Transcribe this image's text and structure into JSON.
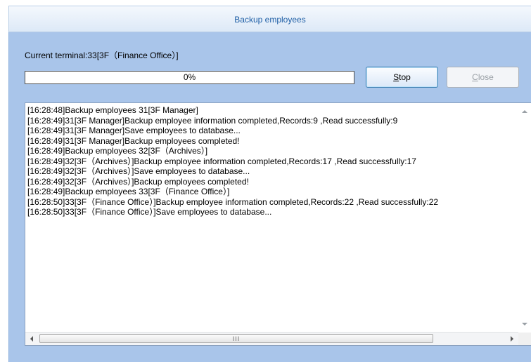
{
  "window": {
    "title": "Backup employees"
  },
  "status": {
    "current_terminal": "Current terminal:33[3F（Finance Office）]"
  },
  "progress": {
    "text": "0%",
    "value_percent": 0
  },
  "buttons": {
    "stop": {
      "accel": "S",
      "rest": "top"
    },
    "close": {
      "accel": "C",
      "rest": "lose",
      "enabled": false
    }
  },
  "log": {
    "lines": [
      "[16:28:48]Backup employees 31[3F Manager]",
      "[16:28:49]31[3F Manager]Backup employee information completed,Records:9 ,Read successfully:9",
      "[16:28:49]31[3F Manager]Save employees to database...",
      "[16:28:49]31[3F Manager]Backup employees completed!",
      "[16:28:49]Backup employees 32[3F（Archives）]",
      "[16:28:49]32[3F（Archives）]Backup employee information completed,Records:17 ,Read successfully:17",
      "[16:28:49]32[3F（Archives）]Save employees to database...",
      "[16:28:49]32[3F（Archives）]Backup employees completed!",
      "[16:28:49]Backup employees 33[3F（Finance Office）]",
      "[16:28:50]33[3F（Finance Office）]Backup employee information completed,Records:22 ,Read successfully:22",
      "[16:28:50]33[3F（Finance Office）]Save employees to database..."
    ]
  },
  "scrollbar": {
    "grip": "III"
  }
}
